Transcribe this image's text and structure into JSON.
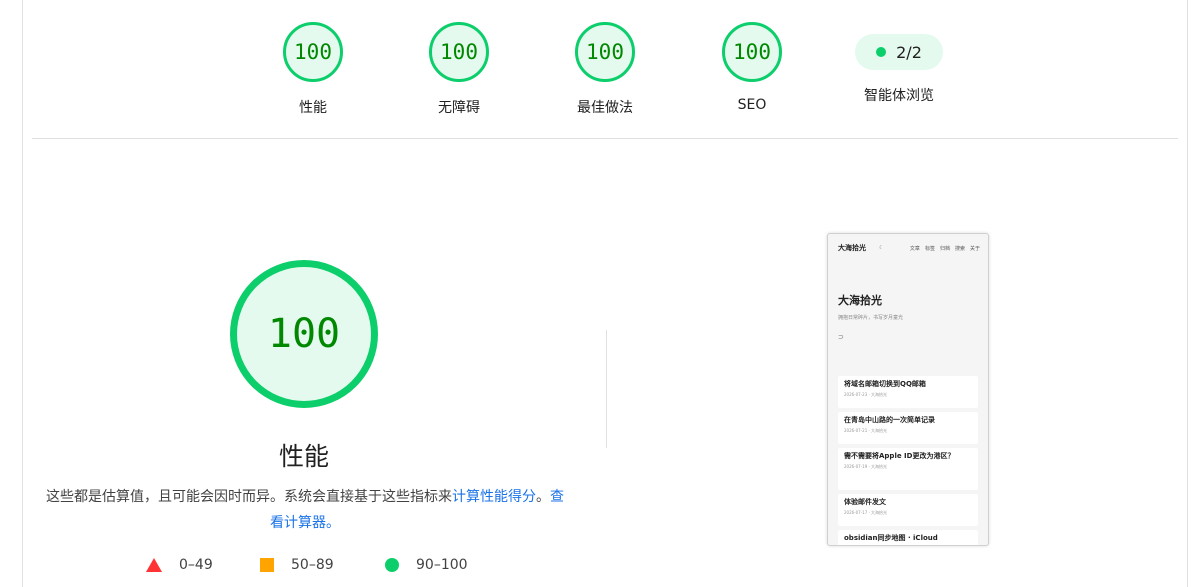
{
  "scores": [
    {
      "value": "100",
      "label": "性能"
    },
    {
      "value": "100",
      "label": "无障碍"
    },
    {
      "value": "100",
      "label": "最佳做法"
    },
    {
      "value": "100",
      "label": "SEO"
    }
  ],
  "agent": {
    "value": "2/2",
    "label": "智能体浏览"
  },
  "performance": {
    "score": "100",
    "title": "性能",
    "desc_text": "这些都是估算值，且可能会因时而异。系统会直接基于这些指标来",
    "desc_link1": "计算性能得分",
    "desc_sep": "。",
    "desc_link2": "查看计算器。"
  },
  "legend": [
    {
      "label": "0–49",
      "color": "#ff3333"
    },
    {
      "label": "50–89",
      "color": "#ffa400"
    },
    {
      "label": "90–100",
      "color": "#0cce6b"
    }
  ],
  "thumbnail": {
    "site_name": "大海拾光",
    "nav": [
      "文章",
      "标签",
      "归档",
      "搜索",
      "关于"
    ],
    "hero_title": "大海拾光",
    "hero_subtitle": "拥抱日常碎片，书写岁月童光",
    "posts": [
      {
        "title": "将域名邮箱切换到QQ邮箱",
        "meta": "2026-07-23 · 大海拾光"
      },
      {
        "title": "在青岛中山路的一次简单记录",
        "meta": "2026-07-21 · 大海拾光"
      },
      {
        "title": "需不需要将Apple ID更改为港区？",
        "meta": "2026-07-19 · 大海拾光"
      },
      {
        "title": "体验邮件发文",
        "meta": "2026-07-17 · 大海拾光"
      },
      {
        "title": "obsidian同步地图 · iCloud",
        "meta": ""
      }
    ]
  }
}
